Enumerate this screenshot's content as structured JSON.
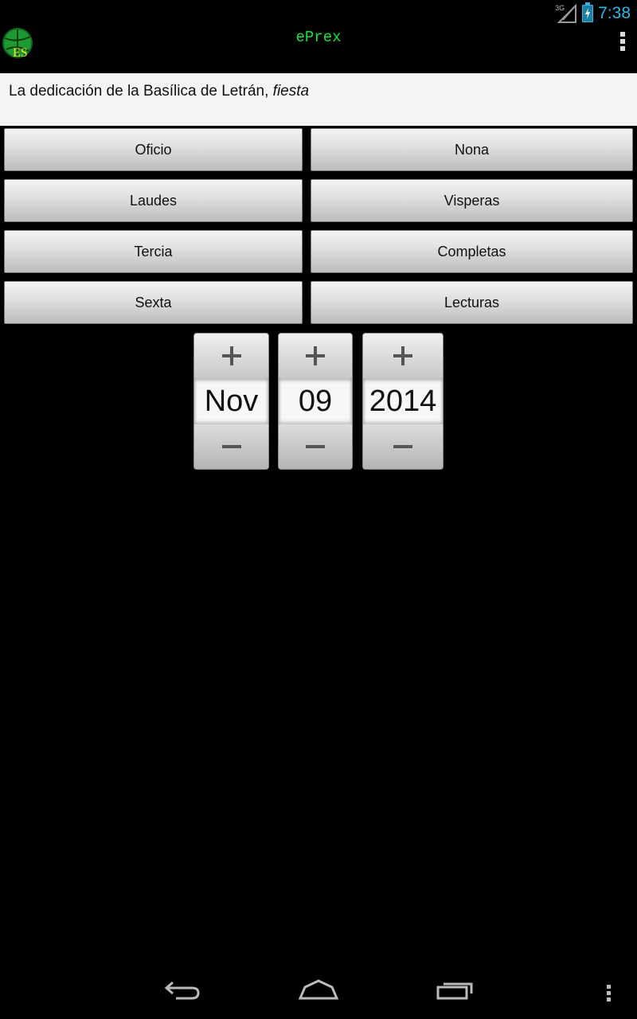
{
  "status_bar": {
    "network": "3G",
    "time": "7:38",
    "accent_color": "#33b5e5"
  },
  "action_bar": {
    "app_icon_text": "ES",
    "title": "ePrex",
    "title_color": "#17e23a",
    "overflow_icon": "overflow-menu-icon"
  },
  "feast": {
    "name": "La dedicación de la Basílica de Letrán, ",
    "rank": "fiesta"
  },
  "hours": {
    "oficio": "Oficio",
    "nona": "Nona",
    "laudes": "Laudes",
    "visperas": "Visperas",
    "tercia": "Tercia",
    "completas": "Completas",
    "sexta": "Sexta",
    "lecturas": "Lecturas"
  },
  "date_picker": {
    "month": "Nov",
    "day": "09",
    "year": "2014",
    "increment_icon": "plus-icon",
    "decrement_icon": "minus-icon"
  },
  "nav_bar": {
    "back_icon": "back-icon",
    "home_icon": "home-icon",
    "recents_icon": "recent-apps-icon",
    "menu_icon": "menu-icon"
  }
}
